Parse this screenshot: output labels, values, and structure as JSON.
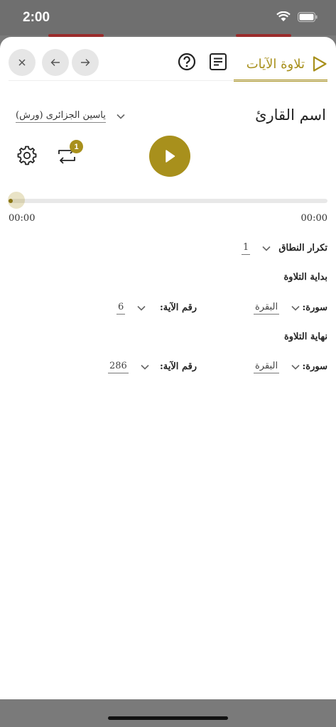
{
  "status_bar": {
    "time": "2:00"
  },
  "header": {
    "active_tab_label": "تلاوة الآيات",
    "icons": [
      "close-icon",
      "arrow-left-icon",
      "arrow-right-icon",
      "help-icon",
      "document-lines-icon",
      "play-outline-icon"
    ]
  },
  "reciter": {
    "title": "اسم القارئ",
    "selected": "ياسين الجزائرى (ورش)"
  },
  "player": {
    "repeat_badge": "1",
    "progress": 0,
    "time_start": "00:00",
    "time_end": "00:00"
  },
  "range_repeat": {
    "label": "تكرار النطاق",
    "value": "1"
  },
  "recitation_start": {
    "title": "بداية التلاوة",
    "surah_label": "سورة:",
    "surah_value": "البقرة",
    "ayah_label": "رقم الآية:",
    "ayah_value": "6"
  },
  "recitation_end": {
    "title": "نهاية التلاوة",
    "surah_label": "سورة:",
    "surah_value": "البقرة",
    "ayah_label": "رقم الآية:",
    "ayah_value": "286"
  },
  "colors": {
    "accent": "#a8901c",
    "track": "#e8e8e8"
  }
}
